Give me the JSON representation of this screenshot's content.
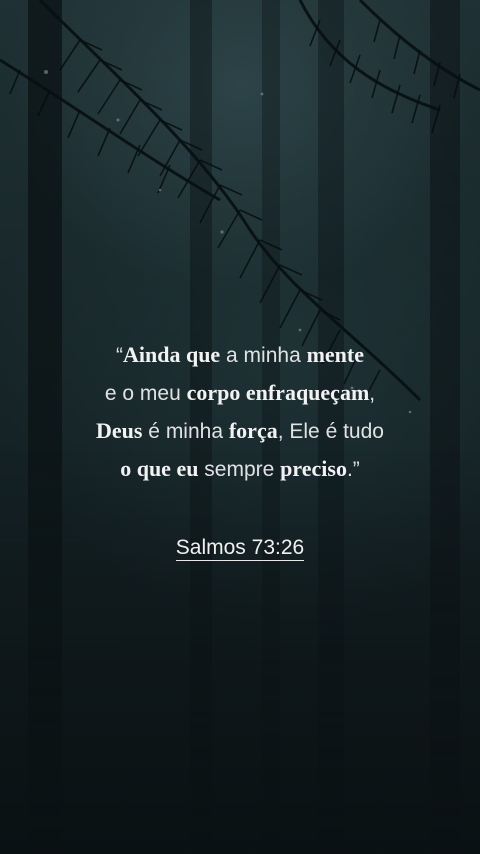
{
  "quote": {
    "open_mark": "“",
    "l1_a": "Ainda que",
    "l1_b": " a minha ",
    "l1_c": "mente",
    "l2_a": "e o meu ",
    "l2_b": "corpo enfraqueçam",
    "l2_c": ",",
    "l3_a": "Deus",
    "l3_b": " é minha ",
    "l3_c": "força",
    "l3_d": ", Ele é tudo",
    "l4_a": "o que eu",
    "l4_b": " sempre ",
    "l4_c": "preciso",
    "l4_d": ".”"
  },
  "reference": "Salmos 73:26"
}
